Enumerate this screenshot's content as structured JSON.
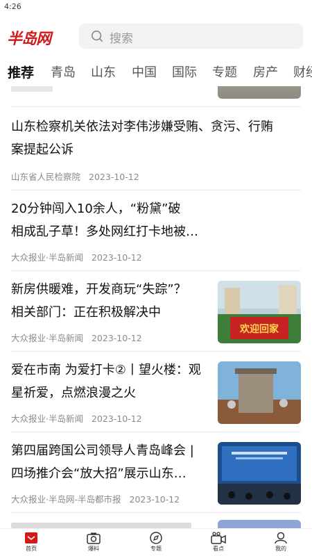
{
  "status": {
    "time": "4:26"
  },
  "header": {
    "logo": "半岛网",
    "search_placeholder": "搜索"
  },
  "tabs": [
    "推荐",
    "青岛",
    "山东",
    "中国",
    "国际",
    "专题",
    "房产",
    "财经"
  ],
  "news": [
    {
      "title_line1": "山东检察机关依法对李伟涉嫌受贿、贪污、行贿",
      "title_line2": "案提起公诉",
      "source": "山东省人民检察院",
      "date": "2023-10-12"
    },
    {
      "title_line1": "20分钟闯入10余人，“粉黛”破",
      "title_line2": "相成乱子草！多处网红打卡地被…",
      "source": "大众报业·半岛新闻",
      "date": "2023-10-12"
    },
    {
      "title_line1": "新房供暖难，开发商玩“失踪”？",
      "title_line2": "相关部门：正在积极解决中",
      "source": "大众报业·半岛新闻",
      "date": "2023-10-12",
      "thumb_text": "欢迎回家"
    },
    {
      "title_line1": "爱在市南 为爱打卡②丨望火楼：观",
      "title_line2": "星祈爱，点燃浪漫之火",
      "source": "大众报业·半岛新闻",
      "date": "2023-10-12"
    },
    {
      "title_line1": "第四届跨国公司领导人青岛峰会 |",
      "title_line2": "四场推介会“放大招”展示山东…",
      "source": "大众报业·半岛网-半岛都市报",
      "date": "2023-10-12"
    }
  ],
  "tabbar": [
    "首页",
    "爆料",
    "专题",
    "看点",
    "我的"
  ],
  "colors": {
    "brand": "#d21a1a",
    "text": "#111111",
    "meta": "#8a8a8a"
  }
}
